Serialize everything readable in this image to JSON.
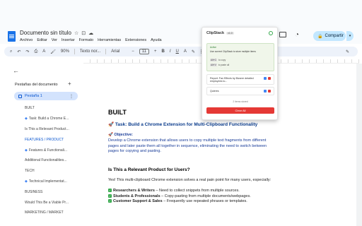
{
  "header": {
    "doc_title": "Documento sin título",
    "menu": [
      "Archivo",
      "Editar",
      "Ver",
      "Insertar",
      "Formato",
      "Herramientas",
      "Extensiones",
      "Ayuda"
    ],
    "share_label": "Compartir"
  },
  "toolbar": {
    "zoom": "90%",
    "style": "Texto nor...",
    "font": "Arial",
    "font_size": "11"
  },
  "sidebar": {
    "heading": "Pestañas del documento",
    "tab_label": "Pestaña 1",
    "items": [
      {
        "label": "BUILT",
        "diamond": false,
        "active": false
      },
      {
        "label": "Task: Build a Chrome E...",
        "diamond": true,
        "active": false
      },
      {
        "label": "Is This a Relevant Product...",
        "diamond": false,
        "active": false
      },
      {
        "label": "FEATURES / PRODUCT",
        "diamond": false,
        "active": true
      },
      {
        "label": "Features & Functionali...",
        "diamond": true,
        "active": false
      },
      {
        "label": "Additional Functionalities...",
        "diamond": false,
        "active": false
      },
      {
        "label": "TECH",
        "diamond": false,
        "active": false
      },
      {
        "label": "Technical Implementat...",
        "diamond": true,
        "active": false
      },
      {
        "label": "BUSINESS",
        "diamond": false,
        "active": false
      },
      {
        "label": "Would This Be a Viable Pr...",
        "diamond": false,
        "active": false
      },
      {
        "label": "MARKETING / MARKET",
        "diamond": false,
        "active": false
      }
    ]
  },
  "document": {
    "h1": "BUILT",
    "task": "🚀 Task: Build a Chrome Extension for Multi-Clipboard Functionality",
    "objective_label": "🚀 Objective:",
    "objective_text": "Develop a Chrome extension that allows users to copy multiple text fragments from different pages and later paste them all together in sequence, eliminating the need to switch between pages for copying and pasting.",
    "h2": "Is This a Relevant Product for Users?",
    "p2": "Yes! This multi-clipboard Chrome extension solves a real pain point for many users, especially:",
    "bullets": [
      {
        "bold": "Researchers & Writers",
        "text": " – Need to collect snippets from multiple sources."
      },
      {
        "bold": "Students & Professionals",
        "text": " – Copy-pasting from multiple documents/webpages."
      },
      {
        "bold": "Customer Support & Sales",
        "text": " – Frequently use repeated phrases or templates."
      }
    ]
  },
  "popup": {
    "title": "ClipStack",
    "version": "v1.0",
    "card_caption": "Active",
    "card_text": "Use current ClipStack to store multiple items",
    "shortcut1_keys": "Alt+C",
    "shortcut1_label": "to copy",
    "shortcut2_keys": "Alt+V",
    "shortcut2_label": "to paste all",
    "item1": "Report: Fan Effects by Bizarre detailed employees to...",
    "item2": "Quieres",
    "stored": "2 items stored",
    "clear_label": "Clear All"
  },
  "colors": {
    "accent": "#0b57d0",
    "share_bg": "#c2e7ff",
    "clear_bg": "#e53935",
    "check": "#36a94c"
  }
}
